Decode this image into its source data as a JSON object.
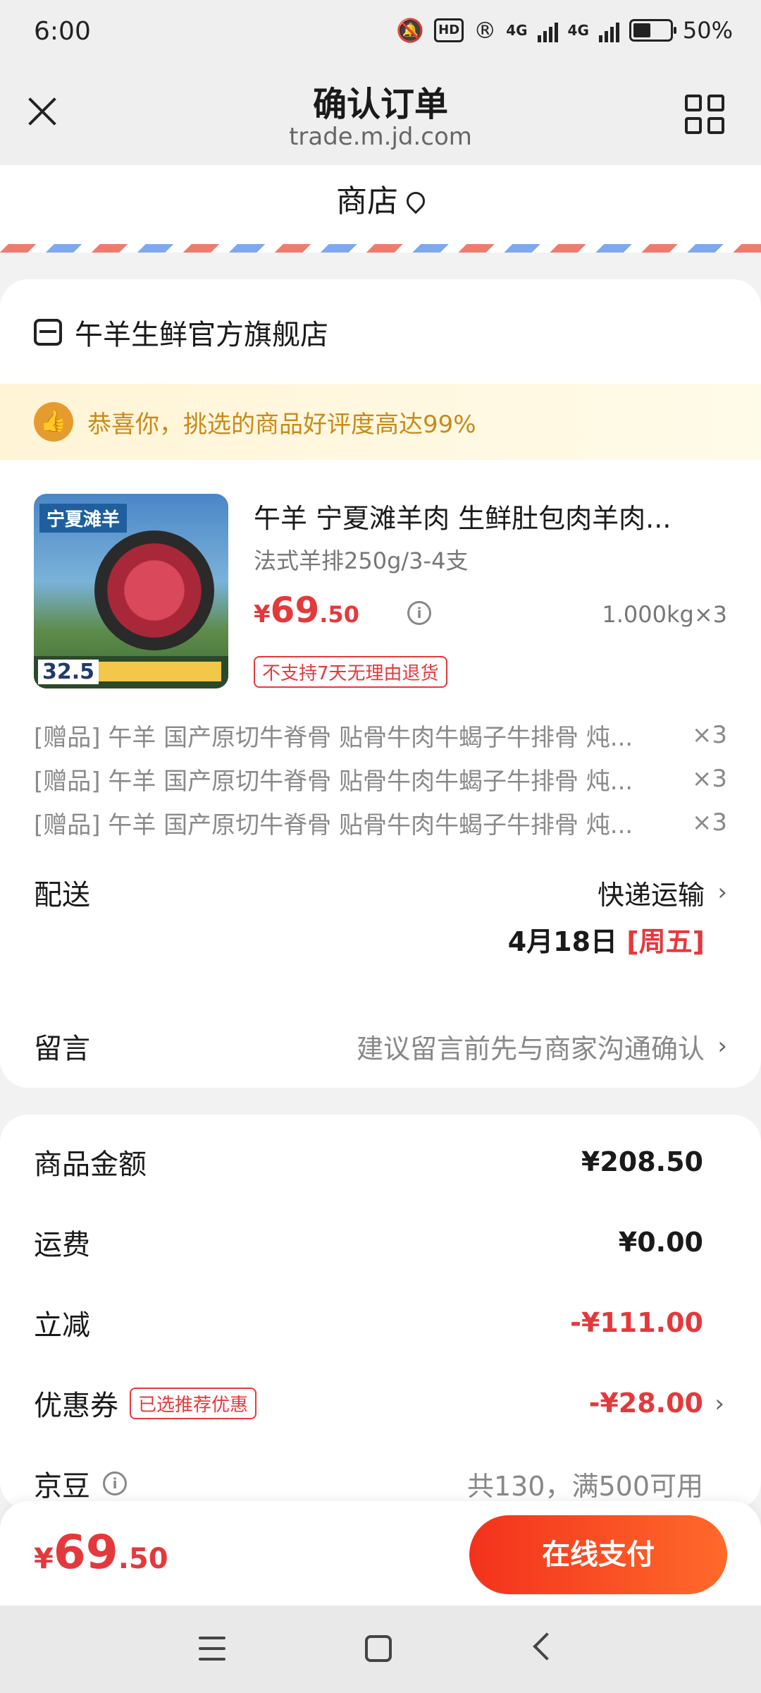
{
  "status_bar": {
    "time": "6:00",
    "hd_label": "HD",
    "network1": "4G",
    "network2": "4G",
    "battery": "50%"
  },
  "header": {
    "title": "确认订单",
    "url": "trade.m.jd.com"
  },
  "shop_bar": {
    "label": "商店"
  },
  "store": {
    "name": "午羊生鲜官方旗舰店"
  },
  "banner": {
    "text": "恭喜你，挑选的商品好评度高达99%"
  },
  "product": {
    "image_tag": "宁夏滩羊",
    "image_price": "32.5",
    "title": "午羊 宁夏滩羊肉 生鲜肚包肉羊肉...",
    "spec": "法式羊排250g/3-4支",
    "price_symbol": "¥",
    "price_int": "69",
    "price_dec": ".50",
    "quantity": "1.000kg×3",
    "no_return": "不支持7天无理由退货"
  },
  "gifts": [
    {
      "text": "[赠品] 午羊 国产原切牛脊骨 贴骨牛肉牛蝎子牛排骨 炖...",
      "qty": "×3"
    },
    {
      "text": "[赠品] 午羊 国产原切牛脊骨 贴骨牛肉牛蝎子牛排骨 炖...",
      "qty": "×3"
    },
    {
      "text": "[赠品] 午羊 国产原切牛脊骨 贴骨牛肉牛蝎子牛排骨 炖...",
      "qty": "×3"
    }
  ],
  "delivery": {
    "label": "配送",
    "method": "快递运输",
    "date": "4月18日",
    "weekday": "[周五]"
  },
  "message": {
    "label": "留言",
    "placeholder": "建议留言前先与商家沟通确认"
  },
  "summary": {
    "goods_label": "商品金额",
    "goods_value": "¥208.50",
    "shipping_label": "运费",
    "shipping_value": "¥0.00",
    "discount_label": "立减",
    "discount_value": "-¥111.00",
    "coupon_label": "优惠券",
    "coupon_badge": "已选推荐优惠",
    "coupon_value": "-¥28.00",
    "jd_label": "京豆",
    "jd_value": "共130，满500可用"
  },
  "bottom": {
    "price_symbol": "¥",
    "price_int": "69",
    "price_dec": ".50",
    "pay_label": "在线支付"
  },
  "colors": {
    "accent_red": "#e4393c",
    "pay_gradient_start": "#f3321d",
    "pay_gradient_end": "#ff6a2a",
    "banner_text": "#c98a1a"
  },
  "icons": [
    "close-icon",
    "grid-menu-icon",
    "location-pin-icon",
    "store-icon",
    "thumbs-up-icon",
    "info-icon",
    "chevron-right-icon"
  ]
}
